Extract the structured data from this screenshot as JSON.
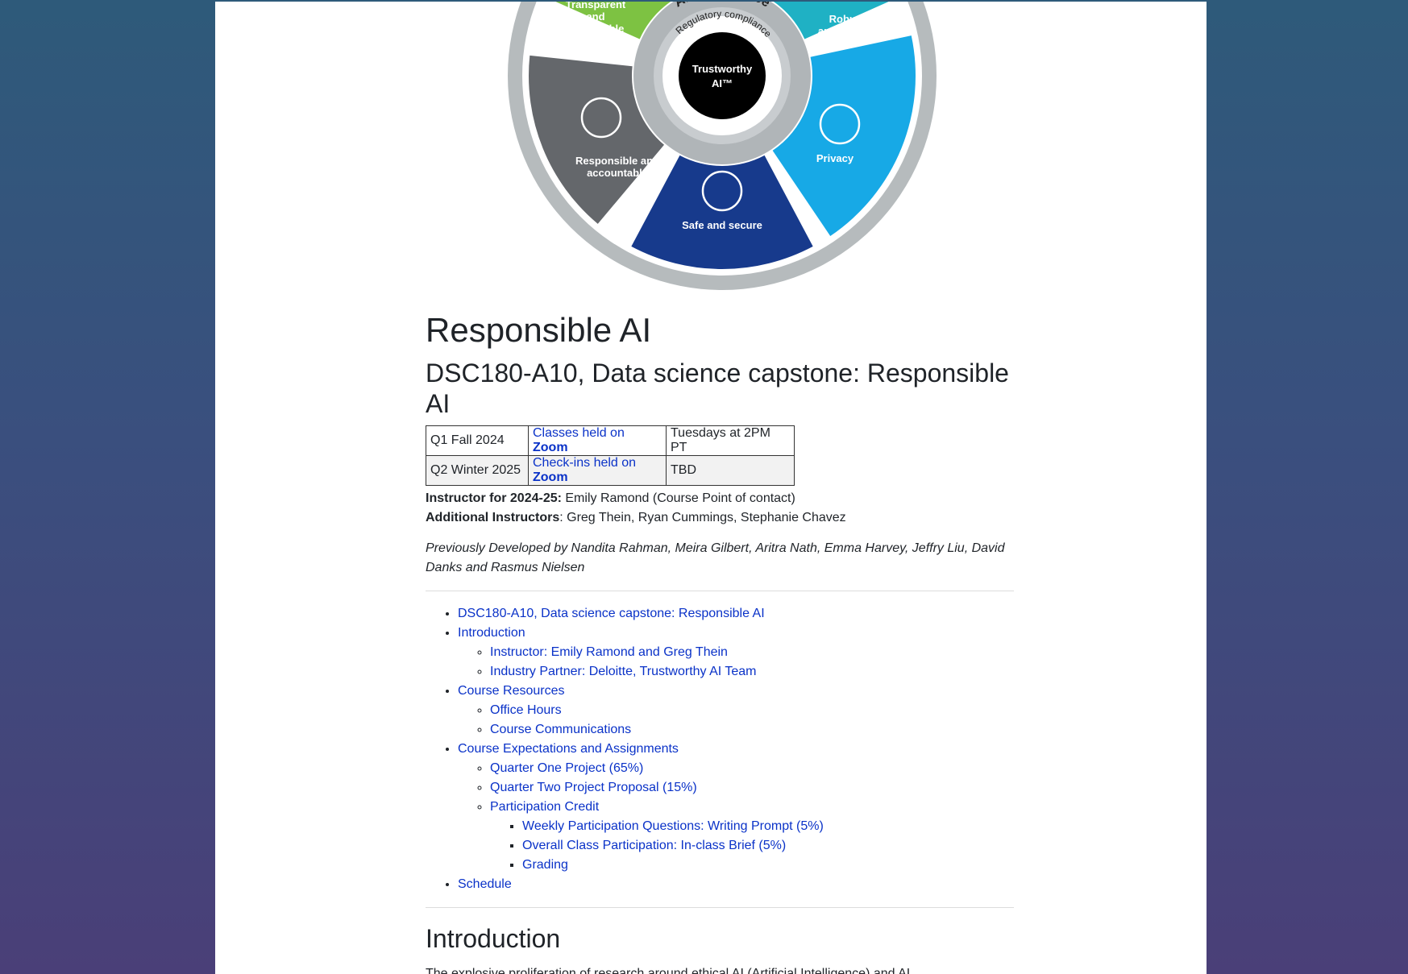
{
  "diagram": {
    "ring_top": "AI governance",
    "ring_mid": "Regulatory compliance",
    "center": [
      "Trustworthy",
      "AI™"
    ],
    "segments": [
      {
        "label": [
          "Transparent",
          "and",
          "explainable"
        ],
        "color": "#7dc242"
      },
      {
        "label": [
          "Robust",
          "and reliable"
        ],
        "color": "#1fb1c4"
      },
      {
        "label": [
          "Privacy"
        ],
        "color": "#17a9e6"
      },
      {
        "label": [
          "Safe and secure"
        ],
        "color": "#173a8c"
      },
      {
        "label": [
          "Responsible and",
          "accountable"
        ],
        "color": "#64676b"
      }
    ]
  },
  "page": {
    "title": "Responsible AI",
    "subtitle": "DSC180-A10, Data science capstone: Responsible AI"
  },
  "schedule": [
    {
      "quarter": "Q1 Fall 2024",
      "link_prefix": "Classes held on ",
      "link_bold": "Zoom",
      "time": "Tuesdays at 2PM PT"
    },
    {
      "quarter": "Q2 Winter 2025",
      "link_prefix": "Check-ins held on ",
      "link_bold": "Zoom",
      "time": "TBD"
    }
  ],
  "instructor": {
    "label": "Instructor for 2024-25:",
    "value": " Emily Ramond (Course Point of contact)"
  },
  "additional": {
    "label": "Additional Instructors",
    "value": ": Greg Thein, Ryan Cummings, Stephanie Chavez"
  },
  "previously": "Previously Developed by Nandita Rahman, Meira Gilbert, Aritra Nath, Emma Harvey, Jeffry Liu, David Danks and Rasmus Nielsen",
  "toc": {
    "course": "DSC180-A10, Data science capstone: Responsible AI",
    "introduction": "Introduction",
    "instructor": "Instructor: Emily Ramond and Greg Thein",
    "industry": "Industry Partner: Deloitte, Trustworthy AI Team",
    "resources": "Course Resources",
    "office_hours": "Office Hours",
    "communications": "Course Communications",
    "expectations": "Course Expectations and Assignments",
    "q1_project": "Quarter One Project (65%)",
    "q2_proposal": "Quarter Two Project Proposal (15%)",
    "participation": "Participation Credit",
    "weekly": "Weekly Participation Questions: Writing Prompt (5%)",
    "overall": "Overall Class Participation: In-class Brief (5%)",
    "grading": "Grading",
    "schedule": "Schedule"
  },
  "intro": {
    "heading": "Introduction",
    "text": "The explosive proliferation of research around ethical AI (Artificial Intelligence) and AI"
  }
}
